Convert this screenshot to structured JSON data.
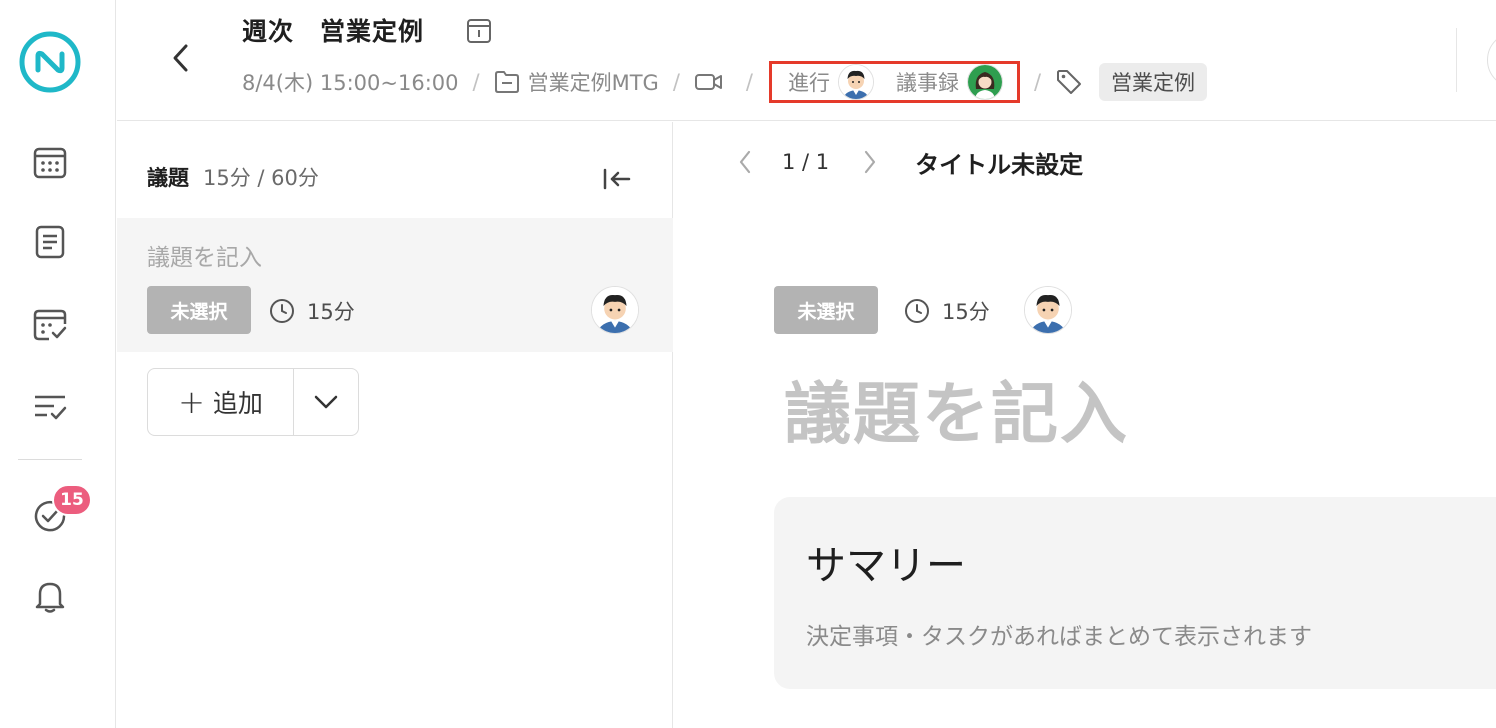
{
  "rail": {
    "items": [
      "logo-icon",
      "calendar-icon",
      "document-icon",
      "calendar-check-icon",
      "list-check-icon",
      "task-check-icon",
      "bell-icon"
    ],
    "task_badge": "15",
    "accent_color": "#1fb8c8",
    "badge_color": "#ec5d7e"
  },
  "header": {
    "title": "週次　営業定例",
    "datetime": "8/4(木) 15:00~16:00",
    "folder": "営業定例MTG",
    "separator": "/",
    "facilitator_label": "進行",
    "minutes_label": "議事録",
    "tag": "営業定例",
    "highlight_color": "#e53a2a"
  },
  "agenda_panel": {
    "label": "議題",
    "time_summary": "15分 / 60分",
    "item": {
      "placeholder": "議題を記入",
      "status": "未選択",
      "duration": "15分"
    },
    "add_label": "追加"
  },
  "main": {
    "page_indicator": "1 / 1",
    "doc_title": "タイトル未設定",
    "status": "未選択",
    "duration": "15分",
    "heading_placeholder": "議題を記入",
    "summary_title": "サマリー",
    "summary_desc": "決定事項・タスクがあればまとめて表示されます"
  }
}
